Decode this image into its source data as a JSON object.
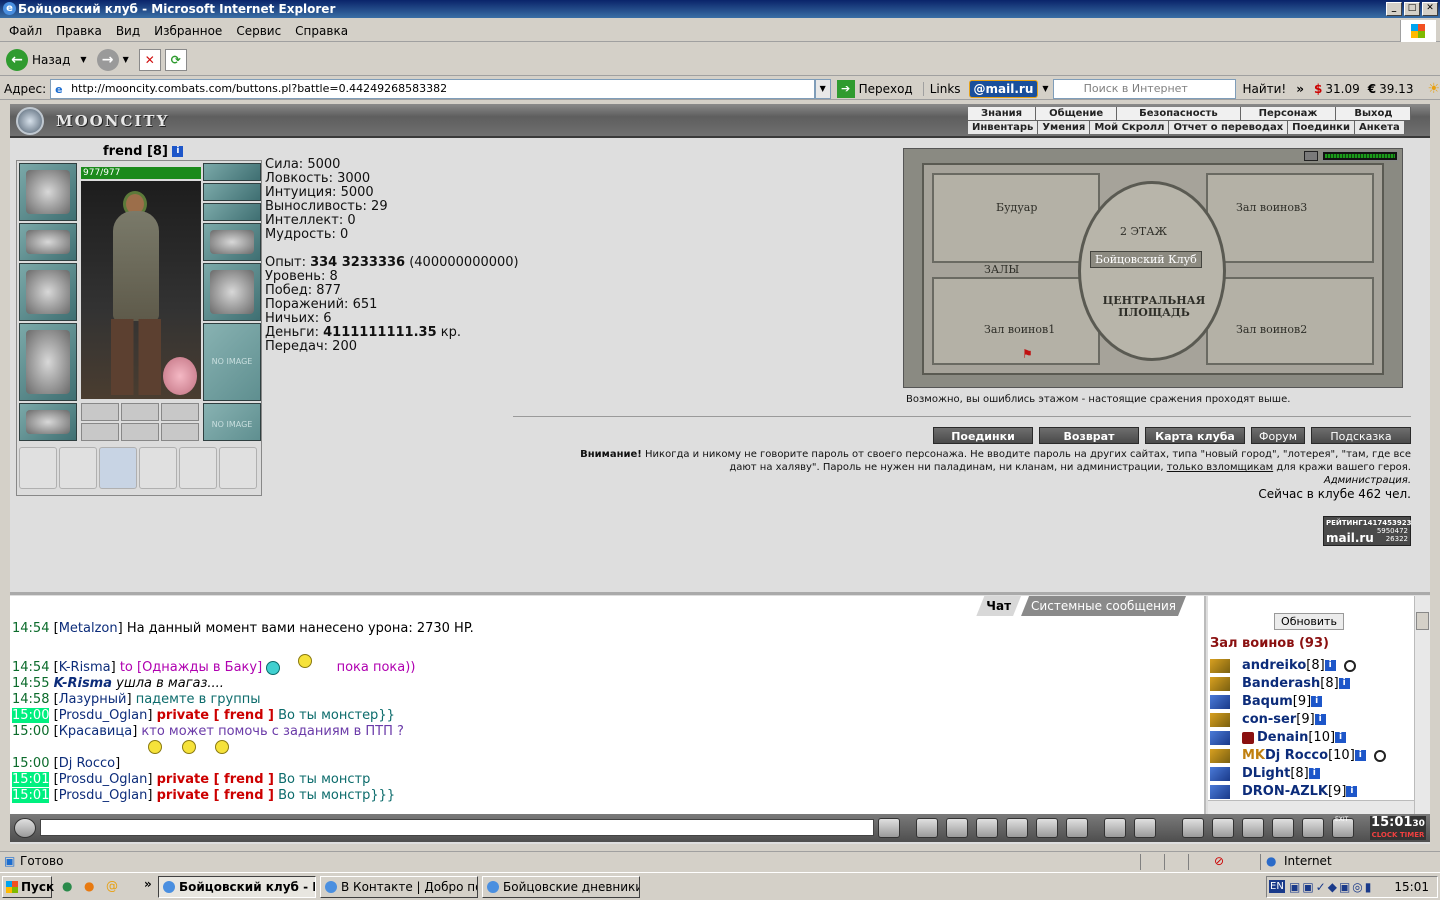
{
  "window": {
    "title": "Бойцовский клуб - Microsoft Internet Explorer"
  },
  "menu": [
    "Файл",
    "Правка",
    "Вид",
    "Избранное",
    "Сервис",
    "Справка"
  ],
  "toolbar": {
    "back_label": "Назад"
  },
  "address": {
    "label": "Адрес:",
    "url": "http://mooncity.combats.com/buttons.pl?battle=0.44249268583382",
    "go_label": "Переход",
    "links_label": "Links",
    "mailru": "@mail.ru",
    "search_placeholder": "Поиск в Интернет",
    "find_label": "Найти!",
    "usd": "31.09",
    "eur": "39.13"
  },
  "site": {
    "logo_text": "MOONCITY",
    "nav_top": [
      "Знания",
      "Общение",
      "Безопасность",
      "Персонаж",
      "Выход"
    ],
    "nav_bottom": [
      "Инвентарь",
      "Умения",
      "Мой Скролл",
      "Отчет о переводах",
      "Поединки",
      "Анкета"
    ]
  },
  "character": {
    "name": "frend",
    "level": "[8]",
    "hp": "977/977",
    "no_image": "NO IMAGE",
    "stats": [
      "Сила: 5000",
      "Ловкость: 3000",
      "Интуиция: 5000",
      "Выносливость: 29",
      "Интеллект: 0",
      "Мудрость: 0"
    ],
    "exp_label": "Опыт:",
    "exp_value": "334 3233336",
    "exp_next": "(400000000000)",
    "level_line": "Уровень: 8",
    "wins": "Побед: 877",
    "losses": "Поражений: 651",
    "draws": "Ничьих: 6",
    "money_label": "Деньги:",
    "money_value": "4111111111.35",
    "money_unit": "кр.",
    "transfers": "Передач: 200"
  },
  "map": {
    "floor": "2 ЭТАЖ",
    "boudoir": "Будуар",
    "hall3": "Зал воинов3",
    "halls": "ЗАЛЫ",
    "club": "Бойцовский Клуб",
    "square": "ЦЕНТРАЛЬНАЯ ПЛОЩАДЬ",
    "hall1": "Зал воинов1",
    "hall2": "Зал воинов2",
    "caption": "Возможно, вы ошиблись этажом - настоящие сражения проходят выше."
  },
  "actions": [
    "Поединки",
    "Возврат",
    "Карта клуба",
    "Форум",
    "Подсказка"
  ],
  "warning": {
    "title": "Внимание!",
    "text1": "Никогда и никому не говорите пароль от своего персонажа. Не вводите пароль на других сайтах, типа \"новый город\", \"лотерея\", \"там, где все",
    "text2": "дают на халяву\". Пароль не нужен ни паладинам, ни кланам, ни администрации,",
    "link": "только взломщикам",
    "text3": "для кражи вашего героя.",
    "admin": "Администрация.",
    "online": "Сейчас в клубе 462 чел."
  },
  "rating": {
    "label": "РЕЙТИНГ",
    "id": "1417453923",
    "brand": "mail.ru",
    "n1": "5950472",
    "n2": "26322"
  },
  "chat": {
    "tabs": [
      "Чат",
      "Системные сообщения"
    ],
    "lines": [
      {
        "time": "14:54",
        "nick": "Metalzon",
        "text": "На данный момент вами нанесено урона: 2730 HP."
      },
      {
        "time": "14:54",
        "nick": "K-Risma",
        "to": "to [Однажды в Баку]",
        "text": "пока пока))"
      },
      {
        "time": "14:55",
        "nick": "K-Risma",
        "text": "ушла в магаз...."
      },
      {
        "time": "14:58",
        "nick": "Лазурный",
        "text": "падемте в группы"
      },
      {
        "time": "15:00",
        "nick": "Prosdu_Oglan",
        "priv": "private [ frend ]",
        "text": "Во ты монстер}}"
      },
      {
        "time": "15:00",
        "nick": "Красавица",
        "text": "кто может помочь с заданиям в ПТП ?"
      },
      {
        "time": "15:00",
        "nick": "Dj Rocco",
        "text": ""
      },
      {
        "time": "15:01",
        "nick": "Prosdu_Oglan",
        "priv": "private [ frend ]",
        "text": "Во ты монстр"
      },
      {
        "time": "15:01",
        "nick": "Prosdu_Oglan",
        "priv": "private [ frend ]",
        "text": "Во ты монстр}}}"
      }
    ]
  },
  "userlist": {
    "refresh": "Обновить",
    "room": "Зал воинов (93)",
    "users": [
      {
        "name": "andreiko",
        "lvl": "[8]"
      },
      {
        "name": "Banderash",
        "lvl": "[8]"
      },
      {
        "name": "Baqum",
        "lvl": "[9]"
      },
      {
        "name": "con-ser",
        "lvl": "[9]"
      },
      {
        "name": "Denain",
        "lvl": "[10]"
      },
      {
        "name": "Dj Rocco",
        "lvl": "[10]",
        "clan": "MK"
      },
      {
        "name": "DLight",
        "lvl": "[8]"
      },
      {
        "name": "DRON-AZLK",
        "lvl": "[9]"
      }
    ]
  },
  "clock": {
    "time": "15:01",
    "sec": "30",
    "label1": "CLOCK",
    "label2": "TIMER",
    "exit": "EXIT"
  },
  "status": {
    "ready": "Готово",
    "zone": "Internet"
  },
  "taskbar": {
    "start": "Пуск",
    "tasks": [
      "Бойцовский клуб - Mi...",
      "В Контакте | Добро по...",
      "Бойцовские дневники -..."
    ],
    "lang": "EN",
    "time": "15:01"
  }
}
